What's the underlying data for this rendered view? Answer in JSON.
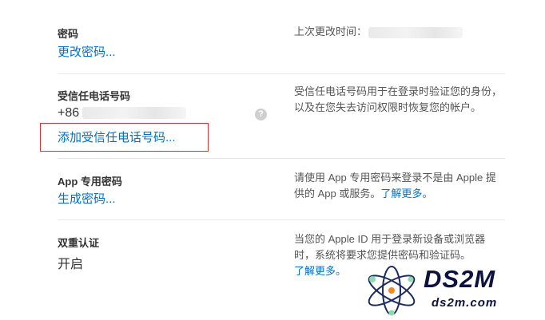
{
  "password": {
    "title": "密码",
    "link": "更改密码...",
    "last_changed_label": "上次更改时间："
  },
  "trusted_phone": {
    "title": "受信任电话号码",
    "number_prefix": "+86",
    "info_icon": "?",
    "add_link": "添加受信任电话号码...",
    "description": "受信任电话号码用于在登录时验证您的身份，以及在您失去访问权限时恢复您的帐户。"
  },
  "app_password": {
    "title": "App 专用密码",
    "link": "生成密码...",
    "description": "请使用 App 专用密码来登录不是由 Apple 提供的 App 或服务。",
    "learn_more": "了解更多。"
  },
  "two_factor": {
    "title": "双重认证",
    "status": "开启",
    "description": "当您的 Apple ID 用于登录新设备或浏览器时，系统将要求您提供密码和验证码。",
    "learn_more": "了解更多。"
  },
  "watermark": {
    "logo": "DS2M",
    "site": "ds2m.com"
  },
  "colors": {
    "link": "#0070c9",
    "highlight": "#d9343b"
  }
}
